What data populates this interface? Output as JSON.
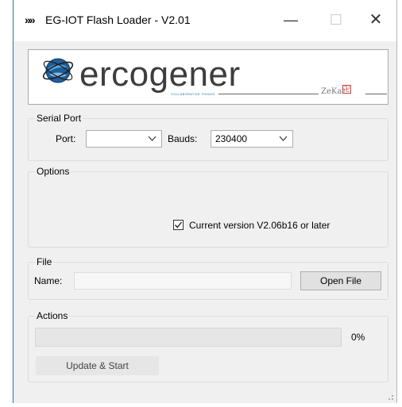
{
  "window": {
    "title": "EG-IOT Flash Loader - V2.01",
    "app_icon": "chevrons-icon",
    "controls": {
      "minimize": "—",
      "maximize": "☐",
      "close": "✕"
    }
  },
  "logo": {
    "brand": "ercogener",
    "tagline": "COLLABORATIVE THINGS",
    "partner": "ZeKat",
    "partner_mark": "卍"
  },
  "serial_port": {
    "group_label": "Serial Port",
    "port_label": "Port:",
    "port_value": "",
    "bauds_label": "Bauds:",
    "bauds_value": "230400"
  },
  "options": {
    "group_label": "Options",
    "current_version_label": "Current version V2.06b16 or later",
    "current_version_checked": true
  },
  "file": {
    "group_label": "File",
    "name_label": "Name:",
    "name_value": "",
    "open_button": "Open File"
  },
  "actions": {
    "group_label": "Actions",
    "progress_percent": 0,
    "progress_text": "0%",
    "update_button": "Update & Start"
  },
  "colors": {
    "window_bg": "#f0f0f0",
    "brand_blue": "#2a6fb0",
    "brand_text": "#3d3d3d",
    "button_bg": "#e1e1e1"
  }
}
